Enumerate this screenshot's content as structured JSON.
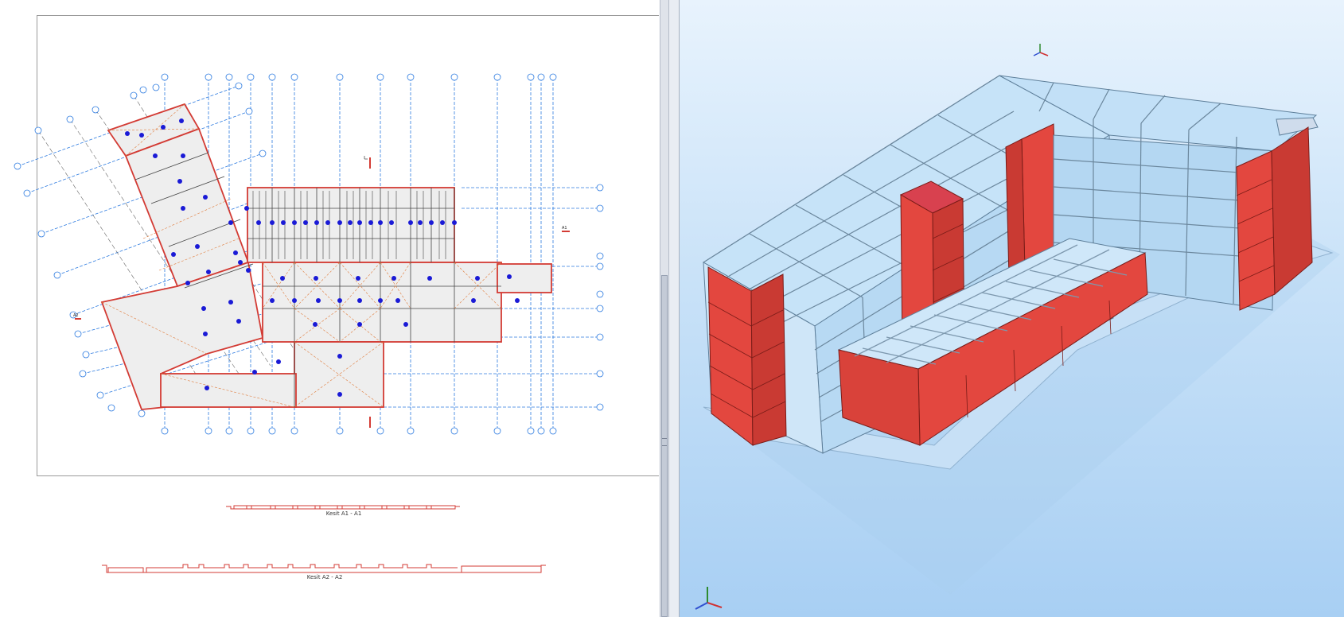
{
  "drawing": {
    "section_a1_label": "Kesit A1 - A1",
    "section_a2_label": "Kesit A2 - A2",
    "section_marker_a1": "A1",
    "section_marker_a2": "A2"
  },
  "colors": {
    "wall_red": "#e3473f",
    "grid_blue": "#2d7be0",
    "column_marker": "#1a1ad6",
    "glass_blue": "#b9dcf6",
    "slab_edge": "#7c93a8"
  },
  "icons": {
    "plan_axis": "axis-triad-icon",
    "model_axis": "xyz-axis-icon"
  }
}
